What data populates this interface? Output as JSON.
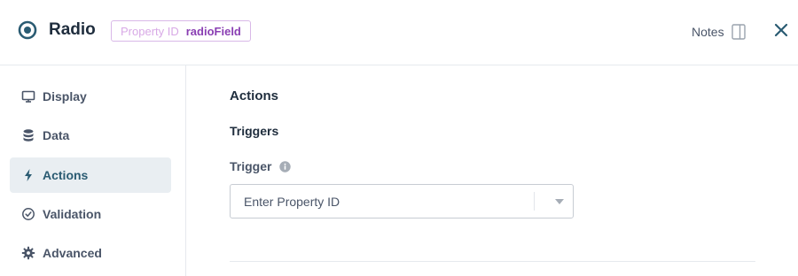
{
  "header": {
    "title": "Radio",
    "property_id_label": "Property ID",
    "property_id_value": "radioField",
    "notes_label": "Notes",
    "icons": {
      "component": "radio-icon",
      "notes": "panel-icon",
      "close": "close-icon"
    }
  },
  "sidebar": {
    "items": [
      {
        "label": "Display",
        "icon": "monitor-icon",
        "active": false
      },
      {
        "label": "Data",
        "icon": "database-icon",
        "active": false
      },
      {
        "label": "Actions",
        "icon": "lightning-icon",
        "active": true
      },
      {
        "label": "Validation",
        "icon": "check-circle-icon",
        "active": false
      },
      {
        "label": "Advanced",
        "icon": "gear-icon",
        "active": false
      }
    ]
  },
  "main": {
    "section_title": "Actions",
    "subsection_title": "Triggers",
    "trigger_label": "Trigger",
    "trigger_placeholder": "Enter Property ID",
    "trigger_value": ""
  },
  "colors": {
    "accent": "#2a5b72",
    "badge_border": "#d9b8e8",
    "badge_value": "#8a3fb3",
    "active_bg": "#e9eef2"
  }
}
